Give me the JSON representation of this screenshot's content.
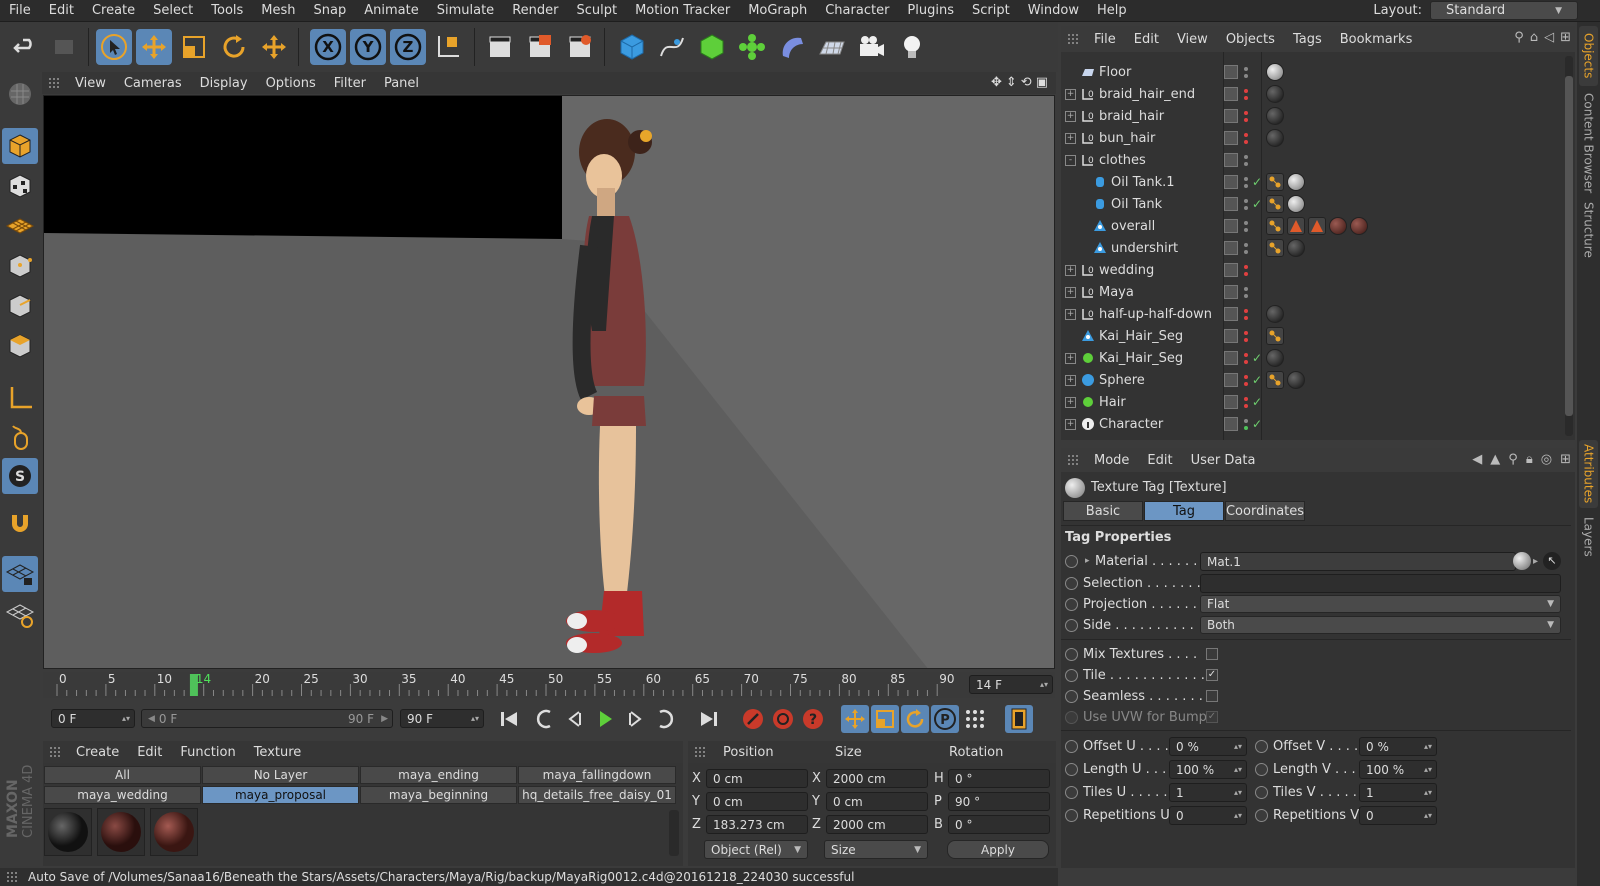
{
  "menubar": {
    "items": [
      "File",
      "Edit",
      "Create",
      "Select",
      "Tools",
      "Mesh",
      "Snap",
      "Animate",
      "Simulate",
      "Render",
      "Sculpt",
      "Motion Tracker",
      "MoGraph",
      "Character",
      "Plugins",
      "Script",
      "Window",
      "Help"
    ],
    "layout_label": "Layout:",
    "layout_value": "Standard"
  },
  "toolbar": {
    "axis_x": "X",
    "axis_y": "Y",
    "axis_z": "Z"
  },
  "viewport": {
    "menu": [
      "View",
      "Cameras",
      "Display",
      "Options",
      "Filter",
      "Panel"
    ]
  },
  "timeline": {
    "ticks": [
      "0",
      "5",
      "10",
      "14",
      "20",
      "25",
      "30",
      "35",
      "40",
      "45",
      "50",
      "55",
      "60",
      "65",
      "70",
      "75",
      "80",
      "85",
      "90"
    ],
    "current_frame_display": "14 F",
    "current_frame": 14,
    "start_field": "0 F",
    "range_start": "0 F",
    "range_end": "90 F",
    "end_field": "90 F"
  },
  "material_manager": {
    "menu": [
      "Create",
      "Edit",
      "Function",
      "Texture"
    ],
    "layers_row1": [
      "All",
      "No Layer",
      "maya_ending",
      "maya_fallingdown"
    ],
    "layers_row2": [
      "maya_wedding",
      "maya_proposal",
      "maya_beginning",
      "hq_details_free_daisy_01"
    ],
    "selected_layer": "maya_proposal"
  },
  "coordinates": {
    "headers": [
      "Position",
      "Size",
      "Rotation"
    ],
    "rows": [
      {
        "pos_axis": "X",
        "pos": "0 cm",
        "size_axis": "X",
        "size": "2000 cm",
        "rot_axis": "H",
        "rot": "0 °"
      },
      {
        "pos_axis": "Y",
        "pos": "0 cm",
        "size_axis": "Y",
        "size": "0 cm",
        "rot_axis": "P",
        "rot": "90 °"
      },
      {
        "pos_axis": "Z",
        "pos": "183.273 cm",
        "size_axis": "Z",
        "size": "2000 cm",
        "rot_axis": "B",
        "rot": "0 °"
      }
    ],
    "mode": "Object (Rel)",
    "size_mode": "Size",
    "apply": "Apply"
  },
  "statusbar": {
    "text": "Auto Save of /Volumes/Sanaa16/Beneath the Stars/Assets/Characters/Maya/Rig/backup/MayaRig0012.c4d@20161218_224030 successful"
  },
  "brand": "MAXON CINEMA 4D",
  "objects": {
    "menu": [
      "File",
      "Edit",
      "View",
      "Objects",
      "Tags",
      "Bookmarks"
    ],
    "rows": [
      {
        "name": "Floor",
        "indent": 0,
        "exp": "",
        "icon": "floor"
      },
      {
        "name": "braid_hair_end",
        "indent": 0,
        "exp": "+",
        "icon": "null"
      },
      {
        "name": "braid_hair",
        "indent": 0,
        "exp": "+",
        "icon": "null"
      },
      {
        "name": "bun_hair",
        "indent": 0,
        "exp": "+",
        "icon": "null"
      },
      {
        "name": "clothes",
        "indent": 0,
        "exp": "-",
        "icon": "null"
      },
      {
        "name": "Oil Tank.1",
        "indent": 1,
        "exp": "",
        "icon": "cyl"
      },
      {
        "name": "Oil Tank",
        "indent": 1,
        "exp": "",
        "icon": "cyl"
      },
      {
        "name": "overall",
        "indent": 1,
        "exp": "",
        "icon": "poly"
      },
      {
        "name": "undershirt",
        "indent": 1,
        "exp": "",
        "icon": "poly"
      },
      {
        "name": "wedding",
        "indent": 0,
        "exp": "+",
        "icon": "null"
      },
      {
        "name": "Maya",
        "indent": 0,
        "exp": "+",
        "icon": "null"
      },
      {
        "name": "half-up-half-down",
        "indent": 0,
        "exp": "+",
        "icon": "null"
      },
      {
        "name": "Kai_Hair_Seg",
        "indent": 0,
        "exp": "",
        "icon": "poly"
      },
      {
        "name": "Kai_Hair_Seg",
        "indent": 0,
        "exp": "+",
        "icon": "hair"
      },
      {
        "name": "Sphere",
        "indent": 0,
        "exp": "+",
        "icon": "sphere"
      },
      {
        "name": "Hair",
        "indent": 0,
        "exp": "+",
        "icon": "hair"
      },
      {
        "name": "Character",
        "indent": 0,
        "exp": "+",
        "icon": "char"
      }
    ]
  },
  "attributes": {
    "menu": [
      "Mode",
      "Edit",
      "User Data"
    ],
    "title": "Texture Tag [Texture]",
    "tabs": [
      "Basic",
      "Tag",
      "Coordinates"
    ],
    "active_tab": "Tag",
    "section": "Tag Properties",
    "material_label": "Material . . . . . . .",
    "material_value": "Mat.1",
    "selection_label": "Selection . . . . . . .",
    "selection_value": "",
    "projection_label": "Projection . . . . . .",
    "projection_value": "Flat",
    "side_label": "Side . . . . . . . . . .",
    "side_value": "Both",
    "mix_label": "Mix Textures . . . .",
    "mix_checked": false,
    "tile_label": "Tile . . . . . . . . . . . .",
    "tile_checked": true,
    "seamless_label": "Seamless . . . . . . .",
    "seamless_checked": false,
    "uvw_label": "Use UVW for Bump",
    "offset_u_label": "Offset U . . . .",
    "offset_u": "0 %",
    "offset_v_label": "Offset V . . . . .",
    "offset_v": "0 %",
    "length_u_label": "Length U . . . .",
    "length_u": "100 %",
    "length_v_label": "Length V . . . .",
    "length_v": "100 %",
    "tiles_u_label": "Tiles U . . . . . .",
    "tiles_u": "1",
    "tiles_v_label": "Tiles V . . . . . .",
    "tiles_v": "1",
    "rep_u_label": "Repetitions U",
    "rep_u": "0",
    "rep_v_label": "Repetitions V",
    "rep_v": "0"
  },
  "side_tabs": {
    "top": [
      "Objects",
      "Content Browser",
      "Structure"
    ],
    "bottom": [
      "Attributes",
      "Layers"
    ]
  },
  "colors": {
    "accent": "#5b87b6",
    "tab_selected": "#e8a32a",
    "panel": "#333333"
  }
}
